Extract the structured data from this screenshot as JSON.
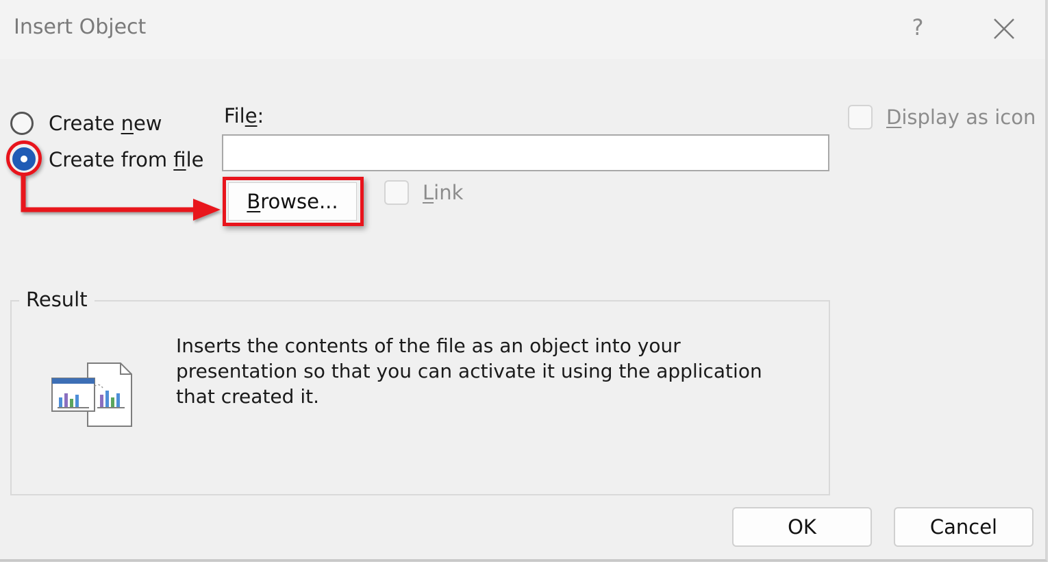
{
  "dialog": {
    "title": "Insert Object",
    "help_label": "?",
    "close_icon": "close-icon"
  },
  "options": {
    "create_new": {
      "pre": "Create ",
      "u": "n",
      "post": "ew",
      "selected": false
    },
    "create_from_file": {
      "pre": "Create from ",
      "u": "f",
      "post": "ile",
      "selected": true
    }
  },
  "file": {
    "label_pre": "Fil",
    "label_u": "e",
    "label_post": ":",
    "value": "",
    "browse_u": "B",
    "browse_post": "rowse..."
  },
  "link": {
    "u": "L",
    "post": "ink",
    "checked": false
  },
  "display_as_icon": {
    "u": "D",
    "post": "isplay as icon",
    "checked": false
  },
  "result": {
    "legend": "Result",
    "description": "Inserts the contents of the file as an object into your presentation so that you can activate it using the application that created it.",
    "icon": "embedded-object-icon"
  },
  "buttons": {
    "ok": "OK",
    "cancel": "Cancel"
  },
  "annotation": {
    "color": "#e8141c"
  },
  "colors": {
    "radio_selected": "#1f5bb5",
    "dialog_bg": "#f0f0f0"
  }
}
